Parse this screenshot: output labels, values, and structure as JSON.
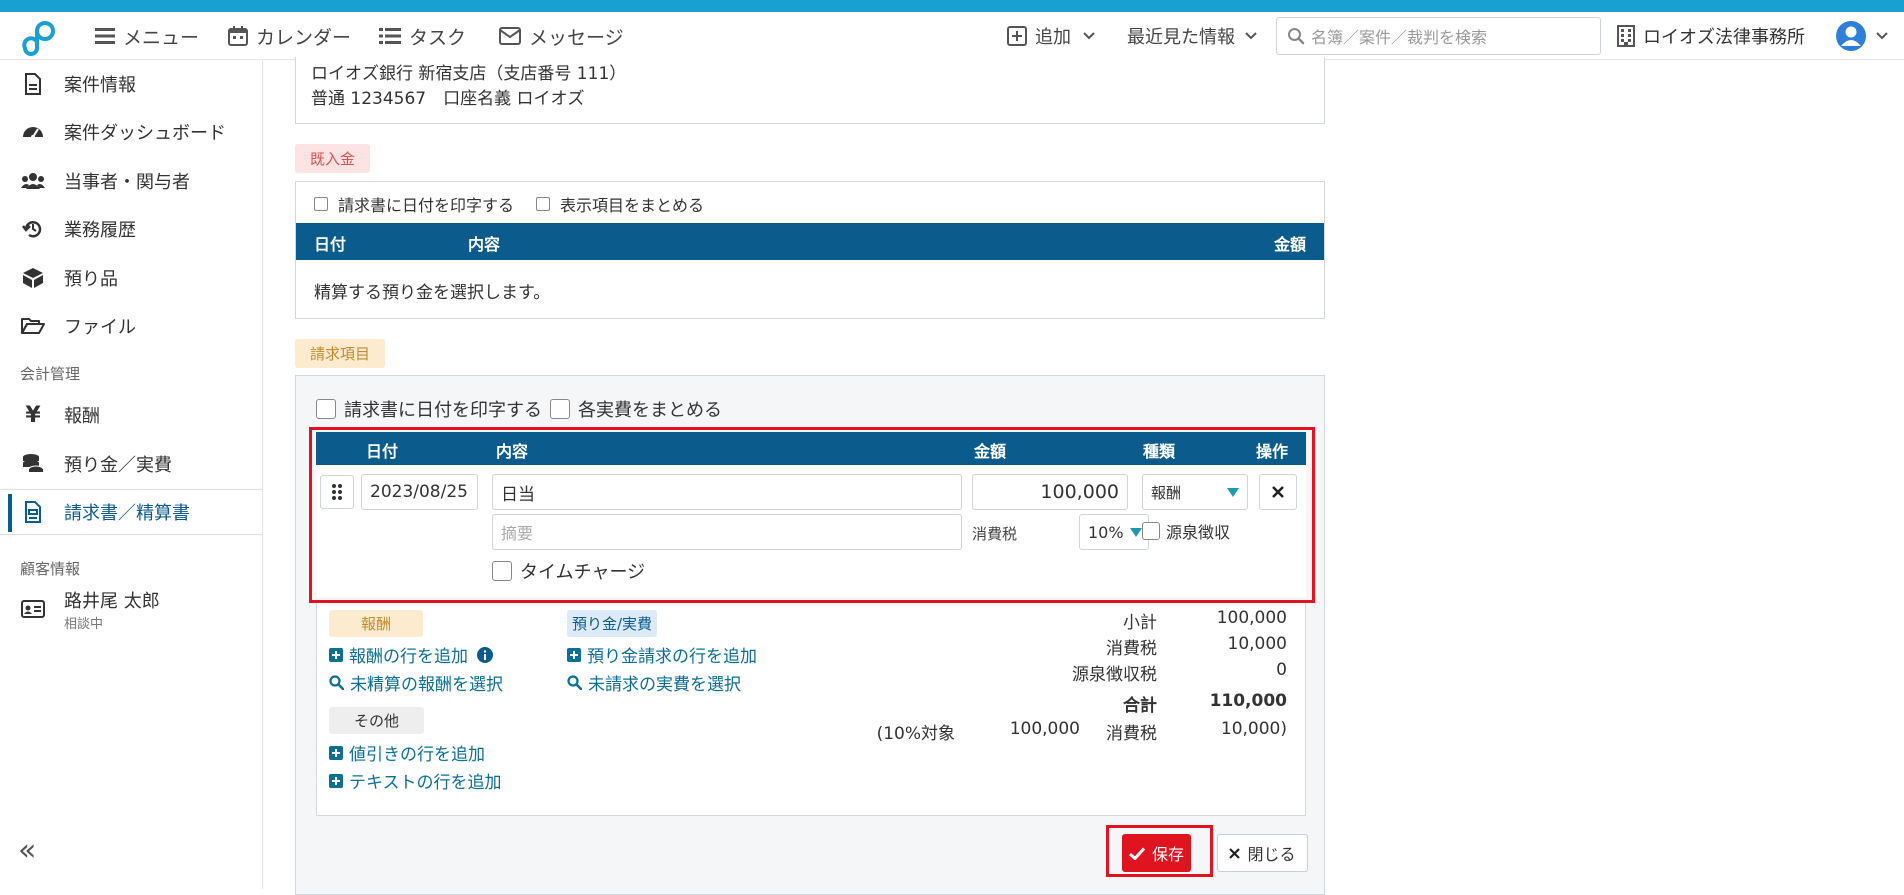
{
  "header": {
    "menu": "メニュー",
    "calendar": "カレンダー",
    "task": "タスク",
    "message": "メッセージ",
    "add": "追加",
    "recent": "最近見た情報",
    "search_placeholder": "名簿／案件／裁判を検索",
    "office": "ロイオズ法律事務所"
  },
  "sidebar": {
    "items": [
      {
        "label": "案件情報"
      },
      {
        "label": "案件ダッシュボード"
      },
      {
        "label": "当事者・関与者"
      },
      {
        "label": "業務履歴"
      },
      {
        "label": "預り品"
      },
      {
        "label": "ファイル"
      }
    ],
    "accounting_section": "会計管理",
    "accounting_items": [
      {
        "label": "報酬"
      },
      {
        "label": "預り金／実費"
      },
      {
        "label": "請求書／精算書"
      }
    ],
    "client_section": "顧客情報",
    "client": {
      "name": "路井尾 太郎",
      "status": "相談中"
    },
    "collapse_label": "«"
  },
  "bank": {
    "line1": "ロイオズ銀行 新宿支店（支店番号 111）",
    "line2": "普通 1234567　口座名義 ロイオズ"
  },
  "received": {
    "badge": "既入金",
    "opt_print_date": "請求書に日付を印字する",
    "opt_group": "表示項目をまとめる",
    "columns": {
      "date": "日付",
      "content": "内容",
      "amount": "金額"
    },
    "empty_text": "精算する預り金を選択します。"
  },
  "billing": {
    "badge": "請求項目",
    "opt_print_date": "請求書に日付を印字する",
    "opt_group_expenses": "各実費をまとめる",
    "columns": {
      "date": "日付",
      "content": "内容",
      "amount": "金額",
      "type": "種類",
      "action": "操作"
    },
    "row": {
      "date": "2023/08/25",
      "content": "日当",
      "amount": "100,000",
      "type": "報酬",
      "memo_placeholder": "摘要",
      "tax_label": "消費税",
      "tax_rate": "10%",
      "withholding": "源泉徴収",
      "timecharge": "タイムチャージ"
    },
    "fee_badge": "報酬",
    "fee_add": "報酬の行を追加",
    "fee_select": "未精算の報酬を選択",
    "deposit_badge": "預り金/実費",
    "deposit_add": "預り金請求の行を追加",
    "deposit_select": "未請求の実費を選択",
    "other_badge": "その他",
    "discount_add": "値引きの行を追加",
    "text_add": "テキストの行を追加",
    "summary": {
      "subtotal_label": "小計",
      "subtotal": "100,000",
      "tax_label": "消費税",
      "tax": "10,000",
      "withholding_label": "源泉徴収税",
      "withholding": "0",
      "total_label": "合計",
      "total": "110,000",
      "breakdown_open": "(10%対象",
      "breakdown_base": "100,000",
      "breakdown_tax_label": "消費税",
      "breakdown_tax": "10,000)"
    },
    "save": "保存",
    "close": "閉じる"
  },
  "colors": {
    "accent": "#0b5b8c",
    "header_strip": "#1aa0d0",
    "danger": "#e0141e",
    "link": "#0b6f96"
  }
}
